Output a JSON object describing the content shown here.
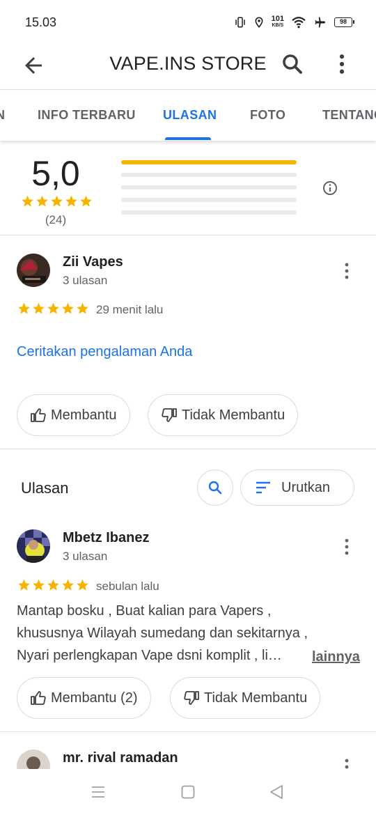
{
  "status_bar": {
    "time": "15.03",
    "speed_value": "101",
    "speed_unit": "KB/S",
    "battery": "98"
  },
  "app_bar": {
    "title": "VAPE.INS STORE",
    "back_icon": "arrow-back-icon",
    "search_icon": "search-icon",
    "more_icon": "more-vert-icon"
  },
  "tabs": {
    "partial_left": "N",
    "items": [
      "INFO TERBARU",
      "ULASAN",
      "FOTO",
      "TENTANG"
    ],
    "active": "ULASAN"
  },
  "summary": {
    "average": "5,0",
    "count": "(24)",
    "stars": 5,
    "distribution": [
      1.0,
      0,
      0,
      0,
      0
    ],
    "star_color": "#f4b400"
  },
  "own_review": {
    "name": "Zii Vapes",
    "reviews": "3 ulasan",
    "stars": 5,
    "time": "29 menit lalu",
    "share_link": "Ceritakan pengalaman Anda",
    "helpful": "Membantu",
    "not_helpful": "Tidak Membantu"
  },
  "reviews_header": {
    "title": "Ulasan",
    "sort_label": "Urutkan"
  },
  "reviews": [
    {
      "name": "Mbetz Ibanez",
      "reviews": "3 ulasan",
      "stars": 5,
      "time": "sebulan lalu",
      "text_lines": [
        "Mantap bosku , Buat kalian para Vapers ,",
        "khususnya Wilayah sumedang dan sekitarnya ,",
        "Nyari perlengkapan Vape dsni komplit , li…"
      ],
      "more": "lainnya",
      "helpful": "Membantu (2)",
      "not_helpful": "Tidak Membantu"
    },
    {
      "name": "mr. rival ramadan"
    }
  ],
  "colors": {
    "accent": "#1a73e8",
    "star": "#f4b400",
    "text": "#202124",
    "secondary": "#5f6368",
    "border": "#dadce0"
  }
}
